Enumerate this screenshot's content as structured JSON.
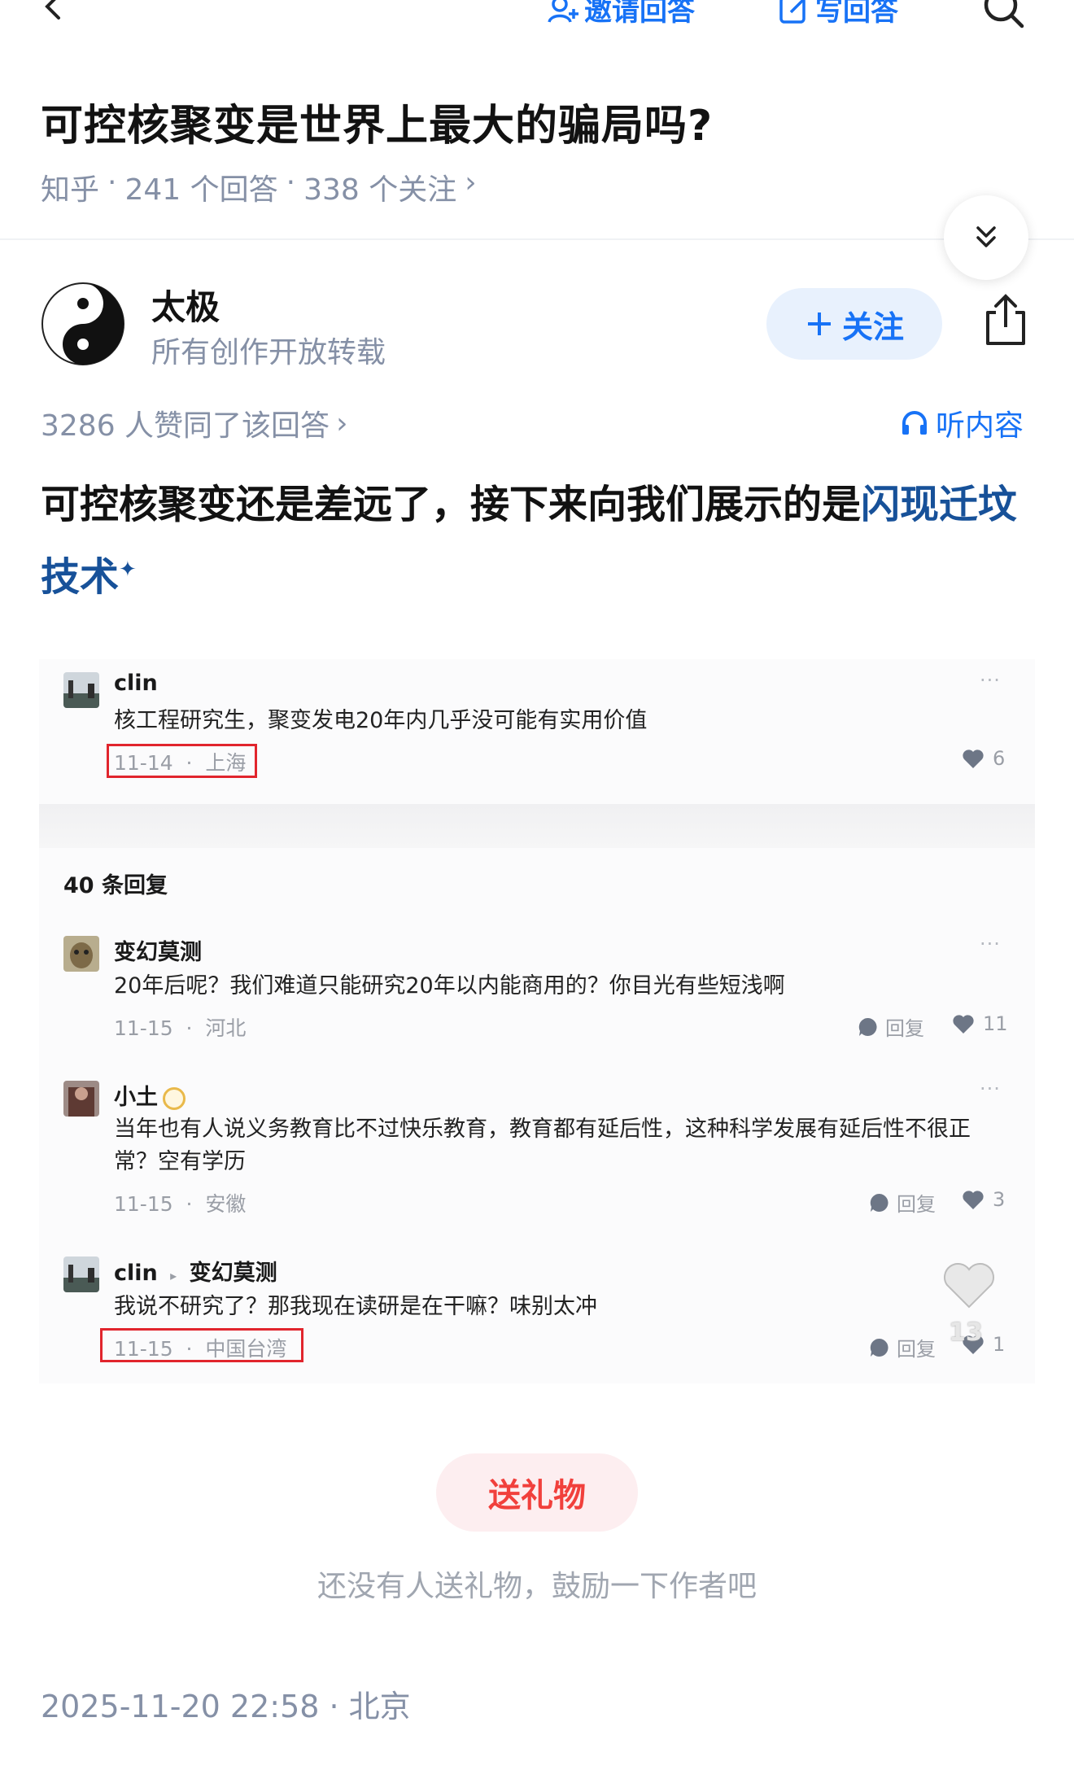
{
  "nav": {
    "invite_label": "邀请回答",
    "write_label": "写回答"
  },
  "question": {
    "title": "可控核聚变是世界上最大的骗局吗?",
    "source": "知乎",
    "answers": "241 个回答",
    "followers": "338 个关注",
    "sep": "·",
    "arrow": "›"
  },
  "author": {
    "name": "太极",
    "description": "所有创作开放转载",
    "follow_label": "关注"
  },
  "answer": {
    "upvote_text": "3286 人赞同了该回答",
    "listen_label": "听内容",
    "text": "可控核聚变还是差远了，接下来向我们展示的是",
    "link_text": "闪现迁坟技术",
    "link_mark": "✦"
  },
  "embedded": {
    "top_comment": {
      "name": "clin",
      "text": "核工程研究生，聚变发电20年内几乎没可能有实用价值",
      "date": "11-14",
      "location": "上海",
      "likes": "6",
      "dots": "···"
    },
    "reply_count_label": "40 条回复",
    "replies": [
      {
        "name": "变幻莫测",
        "text": "20年后呢？我们难道只能研究20年以内能商用的？你目光有些短浅啊",
        "date": "11-15",
        "location": "河北",
        "reply_label": "回复",
        "likes": "11"
      },
      {
        "name": "小土",
        "text": "当年也有人说义务教育比不过快乐教育，教育都有延后性，这种科学发展有延后性不很正常？空有学历",
        "date": "11-15",
        "location": "安徽",
        "reply_label": "回复",
        "likes": "3"
      },
      {
        "name": "clin",
        "reply_to": "变幻莫测",
        "text": "我说不研究了？那我现在读研是在干嘛？味别太冲",
        "date": "11-15",
        "location": "中国台湾",
        "reply_label": "回复",
        "likes": "1"
      }
    ],
    "overlay_like_count": "13"
  },
  "gift": {
    "button_label": "送礼物",
    "hint": "还没有人送礼物，鼓励一下作者吧"
  },
  "footer": {
    "post_time": "2025-11-20 22:58 · 北京"
  },
  "colors": {
    "brand_blue": "#1772f6",
    "link_blue": "#175199",
    "gift_red": "#f1403c",
    "highlight_red": "#e1252d",
    "meta_gray": "#8590a6"
  }
}
